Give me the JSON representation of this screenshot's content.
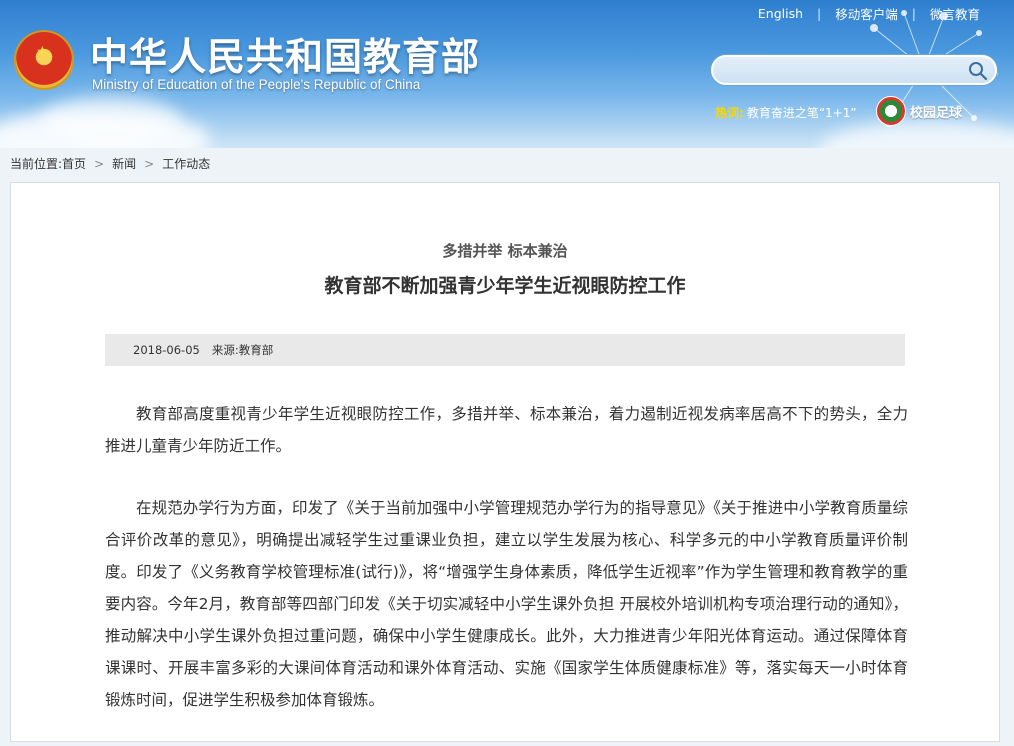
{
  "header": {
    "site_title": "中华人民共和国教育部",
    "site_subtitle": "Ministry of Education of the People's Republic of China",
    "top_links": [
      "English",
      "移动客户端",
      "微言教育"
    ],
    "search": {
      "placeholder": ""
    },
    "hot": {
      "label": "热词:",
      "link": "教育奋进之笔“1+1”"
    },
    "football_label": "校园足球"
  },
  "breadcrumb": {
    "prefix": "当前位置:",
    "items": [
      "首页",
      "新闻",
      "工作动态"
    ]
  },
  "article": {
    "subtitle": "多措并举 标本兼治",
    "title": "教育部不断加强青少年学生近视眼防控工作",
    "date": "2018-06-05",
    "source": "来源:教育部",
    "paragraphs": [
      "教育部高度重视青少年学生近视眼防控工作，多措并举、标本兼治，着力遏制近视发病率居高不下的势头，全力推进儿童青少年防近工作。",
      "在规范办学行为方面，印发了《关于当前加强中小学管理规范办学行为的指导意见》《关于推进中小学教育质量综合评价改革的意见》，明确提出减轻学生过重课业负担，建立以学生发展为核心、科学多元的中小学教育质量评价制度。印发了《义务教育学校管理标准(试行)》，将“增强学生身体素质，降低学生近视率”作为学生管理和教育教学的重要内容。今年2月，教育部等四部门印发《关于切实减轻中小学生课外负担 开展校外培训机构专项治理行动的通知》，推动解决中小学生课外负担过重问题，确保中小学生健康成长。此外，大力推进青少年阳光体育运动。通过保障体育课课时、开展丰富多彩的大课间体育活动和课外体育活动、实施《国家学生体质健康标准》等，落实每天一小时体育锻炼时间，促进学生积极参加体育锻炼。"
    ]
  }
}
